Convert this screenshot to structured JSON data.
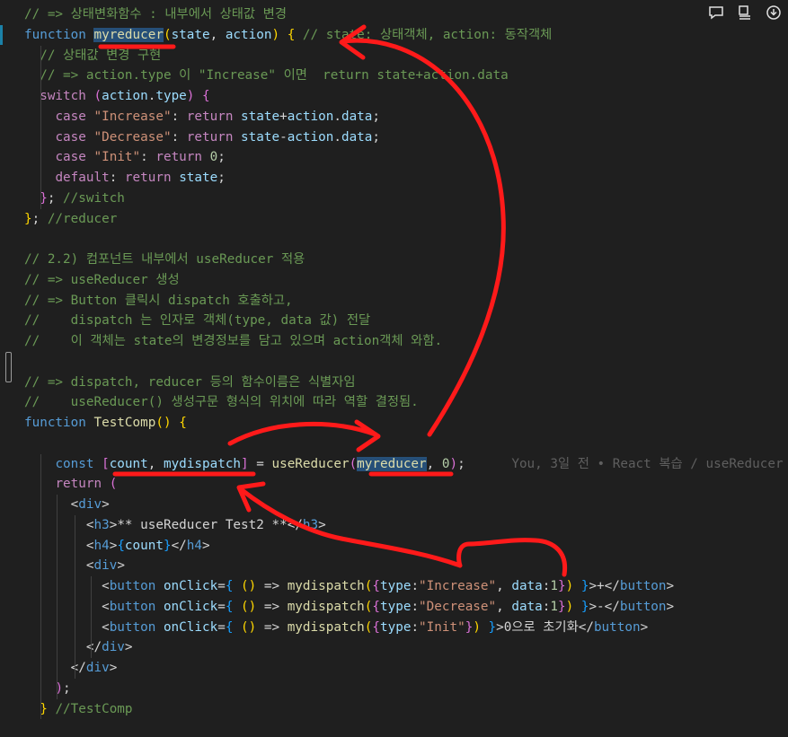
{
  "toolbar": {
    "icons": [
      "comment-icon",
      "open-changes-icon",
      "more-actions-icon"
    ]
  },
  "colors": {
    "background": "#1f1f1f",
    "keyword": "#569cd6",
    "control": "#c586c0",
    "function": "#dcdcaa",
    "variable": "#9cdcfe",
    "string": "#ce9178",
    "number": "#b5cea8",
    "comment": "#6a9955",
    "annotation_red": "#ff1a1a"
  },
  "code": {
    "lines": [
      [
        [
          "cm",
          "// => 상태변화함수 : 내부에서 상태값 변경"
        ]
      ],
      [
        [
          "kw",
          "function"
        ],
        [
          "pun",
          " "
        ],
        [
          "fn hl",
          "myreducer"
        ],
        [
          "br1",
          "("
        ],
        [
          "var",
          "state"
        ],
        [
          "pun",
          ", "
        ],
        [
          "var",
          "action"
        ],
        [
          "br1",
          ")"
        ],
        [
          "pun",
          " "
        ],
        [
          "br1",
          "{"
        ],
        [
          "pun",
          " "
        ],
        [
          "cm",
          "// state: 상태객체, action: 동작객체"
        ]
      ],
      [
        [
          "pun",
          "  "
        ],
        [
          "cm",
          "// 상태값 변경 구현"
        ]
      ],
      [
        [
          "pun",
          "  "
        ],
        [
          "cm",
          "// => action.type 이 \"Increase\" 이면  return state+action.data"
        ]
      ],
      [
        [
          "pun",
          "  "
        ],
        [
          "ctl",
          "switch"
        ],
        [
          "pun",
          " "
        ],
        [
          "br2",
          "("
        ],
        [
          "var",
          "action"
        ],
        [
          "pun",
          "."
        ],
        [
          "var",
          "type"
        ],
        [
          "br2",
          ")"
        ],
        [
          "pun",
          " "
        ],
        [
          "br2",
          "{"
        ]
      ],
      [
        [
          "pun",
          "    "
        ],
        [
          "ctl",
          "case"
        ],
        [
          "pun",
          " "
        ],
        [
          "str",
          "\"Increase\""
        ],
        [
          "pun",
          ": "
        ],
        [
          "ctl",
          "return"
        ],
        [
          "pun",
          " "
        ],
        [
          "var",
          "state"
        ],
        [
          "pun",
          "+"
        ],
        [
          "var",
          "action"
        ],
        [
          "pun",
          "."
        ],
        [
          "var",
          "data"
        ],
        [
          "pun",
          ";"
        ]
      ],
      [
        [
          "pun",
          "    "
        ],
        [
          "ctl",
          "case"
        ],
        [
          "pun",
          " "
        ],
        [
          "str",
          "\"Decrease\""
        ],
        [
          "pun",
          ": "
        ],
        [
          "ctl",
          "return"
        ],
        [
          "pun",
          " "
        ],
        [
          "var",
          "state"
        ],
        [
          "pun",
          "-"
        ],
        [
          "var",
          "action"
        ],
        [
          "pun",
          "."
        ],
        [
          "var",
          "data"
        ],
        [
          "pun",
          ";"
        ]
      ],
      [
        [
          "pun",
          "    "
        ],
        [
          "ctl",
          "case"
        ],
        [
          "pun",
          " "
        ],
        [
          "str",
          "\"Init\""
        ],
        [
          "pun",
          ": "
        ],
        [
          "ctl",
          "return"
        ],
        [
          "pun",
          " "
        ],
        [
          "num",
          "0"
        ],
        [
          "pun",
          ";"
        ]
      ],
      [
        [
          "pun",
          "    "
        ],
        [
          "ctl",
          "default"
        ],
        [
          "pun",
          ": "
        ],
        [
          "ctl",
          "return"
        ],
        [
          "pun",
          " "
        ],
        [
          "var",
          "state"
        ],
        [
          "pun",
          ";"
        ]
      ],
      [
        [
          "pun",
          "  "
        ],
        [
          "br2",
          "}"
        ],
        [
          "pun",
          "; "
        ],
        [
          "cm",
          "//switch"
        ]
      ],
      [
        [
          "br1",
          "}"
        ],
        [
          "pun",
          "; "
        ],
        [
          "cm",
          "//reducer"
        ]
      ],
      [],
      [
        [
          "cm",
          "// 2.2) 컴포넌트 내부에서 useReducer 적용"
        ]
      ],
      [
        [
          "cm",
          "// => useReducer 생성"
        ]
      ],
      [
        [
          "cm",
          "// => Button 클릭시 dispatch 호출하고,"
        ]
      ],
      [
        [
          "cm",
          "//    dispatch 는 인자로 객체(type, data 값) 전달"
        ]
      ],
      [
        [
          "cm",
          "//    이 객체는 state의 변경정보를 담고 있으며 action객체 와함."
        ]
      ],
      [],
      [
        [
          "cm",
          "// => dispatch, reducer 등의 함수이름은 식별자임"
        ]
      ],
      [
        [
          "cm",
          "//    useReducer() 생성구문 형식의 위치에 따라 역할 결정됨."
        ]
      ],
      [
        [
          "kw",
          "function"
        ],
        [
          "pun",
          " "
        ],
        [
          "fn",
          "TestComp"
        ],
        [
          "br1",
          "()"
        ],
        [
          "pun",
          " "
        ],
        [
          "br1",
          "{"
        ]
      ],
      [],
      [
        [
          "pun",
          "    "
        ],
        [
          "kw",
          "const"
        ],
        [
          "pun",
          " "
        ],
        [
          "br2",
          "["
        ],
        [
          "var",
          "count"
        ],
        [
          "pun",
          ", "
        ],
        [
          "var",
          "mydispatch"
        ],
        [
          "br2",
          "]"
        ],
        [
          "pun",
          " = "
        ],
        [
          "fn",
          "useReducer"
        ],
        [
          "br2",
          "("
        ],
        [
          "fn hl",
          "myreducer"
        ],
        [
          "pun",
          ", "
        ],
        [
          "num",
          "0"
        ],
        [
          "br2",
          ")"
        ],
        [
          "pun",
          ";"
        ],
        [
          "pun",
          "      "
        ],
        [
          "blame",
          "You, 3일 전 • React 복습 / useReducer"
        ]
      ],
      [
        [
          "pun",
          "    "
        ],
        [
          "ctl",
          "return"
        ],
        [
          "pun",
          " "
        ],
        [
          "br2",
          "("
        ]
      ],
      [
        [
          "pun",
          "      "
        ],
        [
          "pun",
          "<"
        ],
        [
          "tag",
          "div"
        ],
        [
          "pun",
          ">"
        ]
      ],
      [
        [
          "pun",
          "        "
        ],
        [
          "pun",
          "<"
        ],
        [
          "tag",
          "h3"
        ],
        [
          "pun",
          ">"
        ],
        [
          "pun",
          "** useReducer Test2 **"
        ],
        [
          "pun",
          "</"
        ],
        [
          "tag",
          "h3"
        ],
        [
          "pun",
          ">"
        ]
      ],
      [
        [
          "pun",
          "        "
        ],
        [
          "pun",
          "<"
        ],
        [
          "tag",
          "h4"
        ],
        [
          "pun",
          ">"
        ],
        [
          "br3",
          "{"
        ],
        [
          "var",
          "count"
        ],
        [
          "br3",
          "}"
        ],
        [
          "pun",
          "</"
        ],
        [
          "tag",
          "h4"
        ],
        [
          "pun",
          ">"
        ]
      ],
      [
        [
          "pun",
          "        "
        ],
        [
          "pun",
          "<"
        ],
        [
          "tag",
          "div"
        ],
        [
          "pun",
          ">"
        ]
      ],
      [
        [
          "pun",
          "          "
        ],
        [
          "pun",
          "<"
        ],
        [
          "tag",
          "button"
        ],
        [
          "pun",
          " "
        ],
        [
          "attr",
          "onClick"
        ],
        [
          "pun",
          "="
        ],
        [
          "br3",
          "{"
        ],
        [
          "pun",
          " "
        ],
        [
          "br1",
          "()"
        ],
        [
          "pun",
          " => "
        ],
        [
          "fn",
          "mydispatch"
        ],
        [
          "br1",
          "("
        ],
        [
          "br2",
          "{"
        ],
        [
          "var",
          "type"
        ],
        [
          "pun",
          ":"
        ],
        [
          "str",
          "\"Increase\""
        ],
        [
          "pun",
          ", "
        ],
        [
          "var",
          "data"
        ],
        [
          "pun",
          ":"
        ],
        [
          "num",
          "1"
        ],
        [
          "br2",
          "}"
        ],
        [
          "br1",
          ")"
        ],
        [
          "pun",
          " "
        ],
        [
          "br3",
          "}"
        ],
        [
          "pun",
          ">+</"
        ],
        [
          "tag",
          "button"
        ],
        [
          "pun",
          ">"
        ]
      ],
      [
        [
          "pun",
          "          "
        ],
        [
          "pun",
          "<"
        ],
        [
          "tag",
          "button"
        ],
        [
          "pun",
          " "
        ],
        [
          "attr",
          "onClick"
        ],
        [
          "pun",
          "="
        ],
        [
          "br3",
          "{"
        ],
        [
          "pun",
          " "
        ],
        [
          "br1",
          "()"
        ],
        [
          "pun",
          " => "
        ],
        [
          "fn",
          "mydispatch"
        ],
        [
          "br1",
          "("
        ],
        [
          "br2",
          "{"
        ],
        [
          "var",
          "type"
        ],
        [
          "pun",
          ":"
        ],
        [
          "str",
          "\"Decrease\""
        ],
        [
          "pun",
          ", "
        ],
        [
          "var",
          "data"
        ],
        [
          "pun",
          ":"
        ],
        [
          "num",
          "1"
        ],
        [
          "br2",
          "}"
        ],
        [
          "br1",
          ")"
        ],
        [
          "pun",
          " "
        ],
        [
          "br3",
          "}"
        ],
        [
          "pun",
          ">-</"
        ],
        [
          "tag",
          "button"
        ],
        [
          "pun",
          ">"
        ]
      ],
      [
        [
          "pun",
          "          "
        ],
        [
          "pun",
          "<"
        ],
        [
          "tag",
          "button"
        ],
        [
          "pun",
          " "
        ],
        [
          "attr",
          "onClick"
        ],
        [
          "pun",
          "="
        ],
        [
          "br3",
          "{"
        ],
        [
          "pun",
          " "
        ],
        [
          "br1",
          "()"
        ],
        [
          "pun",
          " => "
        ],
        [
          "fn",
          "mydispatch"
        ],
        [
          "br1",
          "("
        ],
        [
          "br2",
          "{"
        ],
        [
          "var",
          "type"
        ],
        [
          "pun",
          ":"
        ],
        [
          "str",
          "\"Init\""
        ],
        [
          "br2",
          "}"
        ],
        [
          "br1",
          ")"
        ],
        [
          "pun",
          " "
        ],
        [
          "br3",
          "}"
        ],
        [
          "pun",
          ">0으로 초기화</"
        ],
        [
          "tag",
          "button"
        ],
        [
          "pun",
          ">"
        ]
      ],
      [
        [
          "pun",
          "        "
        ],
        [
          "pun",
          "</"
        ],
        [
          "tag",
          "div"
        ],
        [
          "pun",
          ">"
        ]
      ],
      [
        [
          "pun",
          "      "
        ],
        [
          "pun",
          "</"
        ],
        [
          "tag",
          "div"
        ],
        [
          "pun",
          ">"
        ]
      ],
      [
        [
          "pun",
          "    "
        ],
        [
          "br2",
          ")"
        ],
        [
          "pun",
          ";"
        ]
      ],
      [
        [
          "pun",
          "  "
        ],
        [
          "br1",
          "}"
        ],
        [
          "pun",
          " "
        ],
        [
          "cm",
          "//TestComp"
        ]
      ]
    ]
  }
}
